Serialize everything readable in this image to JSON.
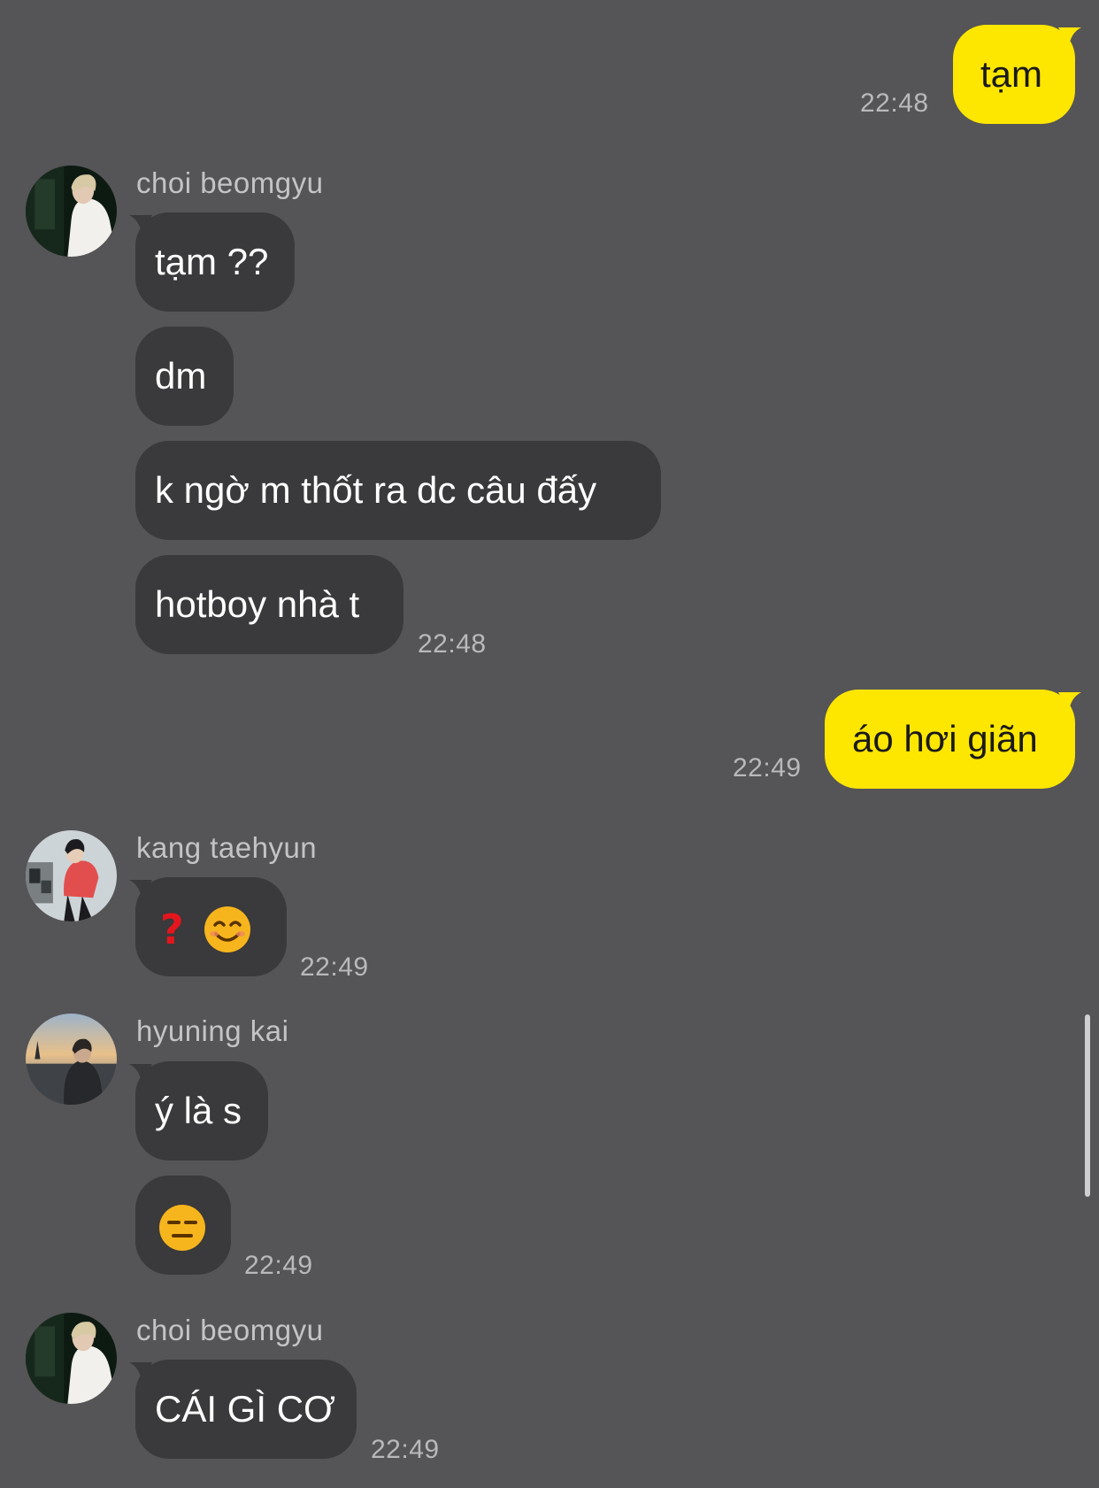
{
  "messages": {
    "out1": {
      "text": "tạm",
      "time": "22:48"
    },
    "group1": {
      "sender": "choi beomgyu",
      "b1": "tạm ??",
      "b2": "dm",
      "b3": "k ngờ m thốt ra dc câu đấy",
      "b4": "hotboy nhà t",
      "time": "22:48"
    },
    "out2": {
      "text": "áo hơi giãn",
      "time": "22:49"
    },
    "group2": {
      "sender": "kang taehyun",
      "b1": "❓ 😊",
      "time": "22:49"
    },
    "group3": {
      "sender": "hyuning kai",
      "b1": "ý là s",
      "b2": "😑",
      "time": "22:49"
    },
    "group4": {
      "sender": "choi beomgyu",
      "b1": "CÁI GÌ CƠ",
      "time": "22:49"
    }
  },
  "colors": {
    "background": "#555456",
    "incoming_bubble": "#3a393b",
    "outgoing_bubble": "#fde600",
    "timestamp": "#b9b8bb"
  }
}
